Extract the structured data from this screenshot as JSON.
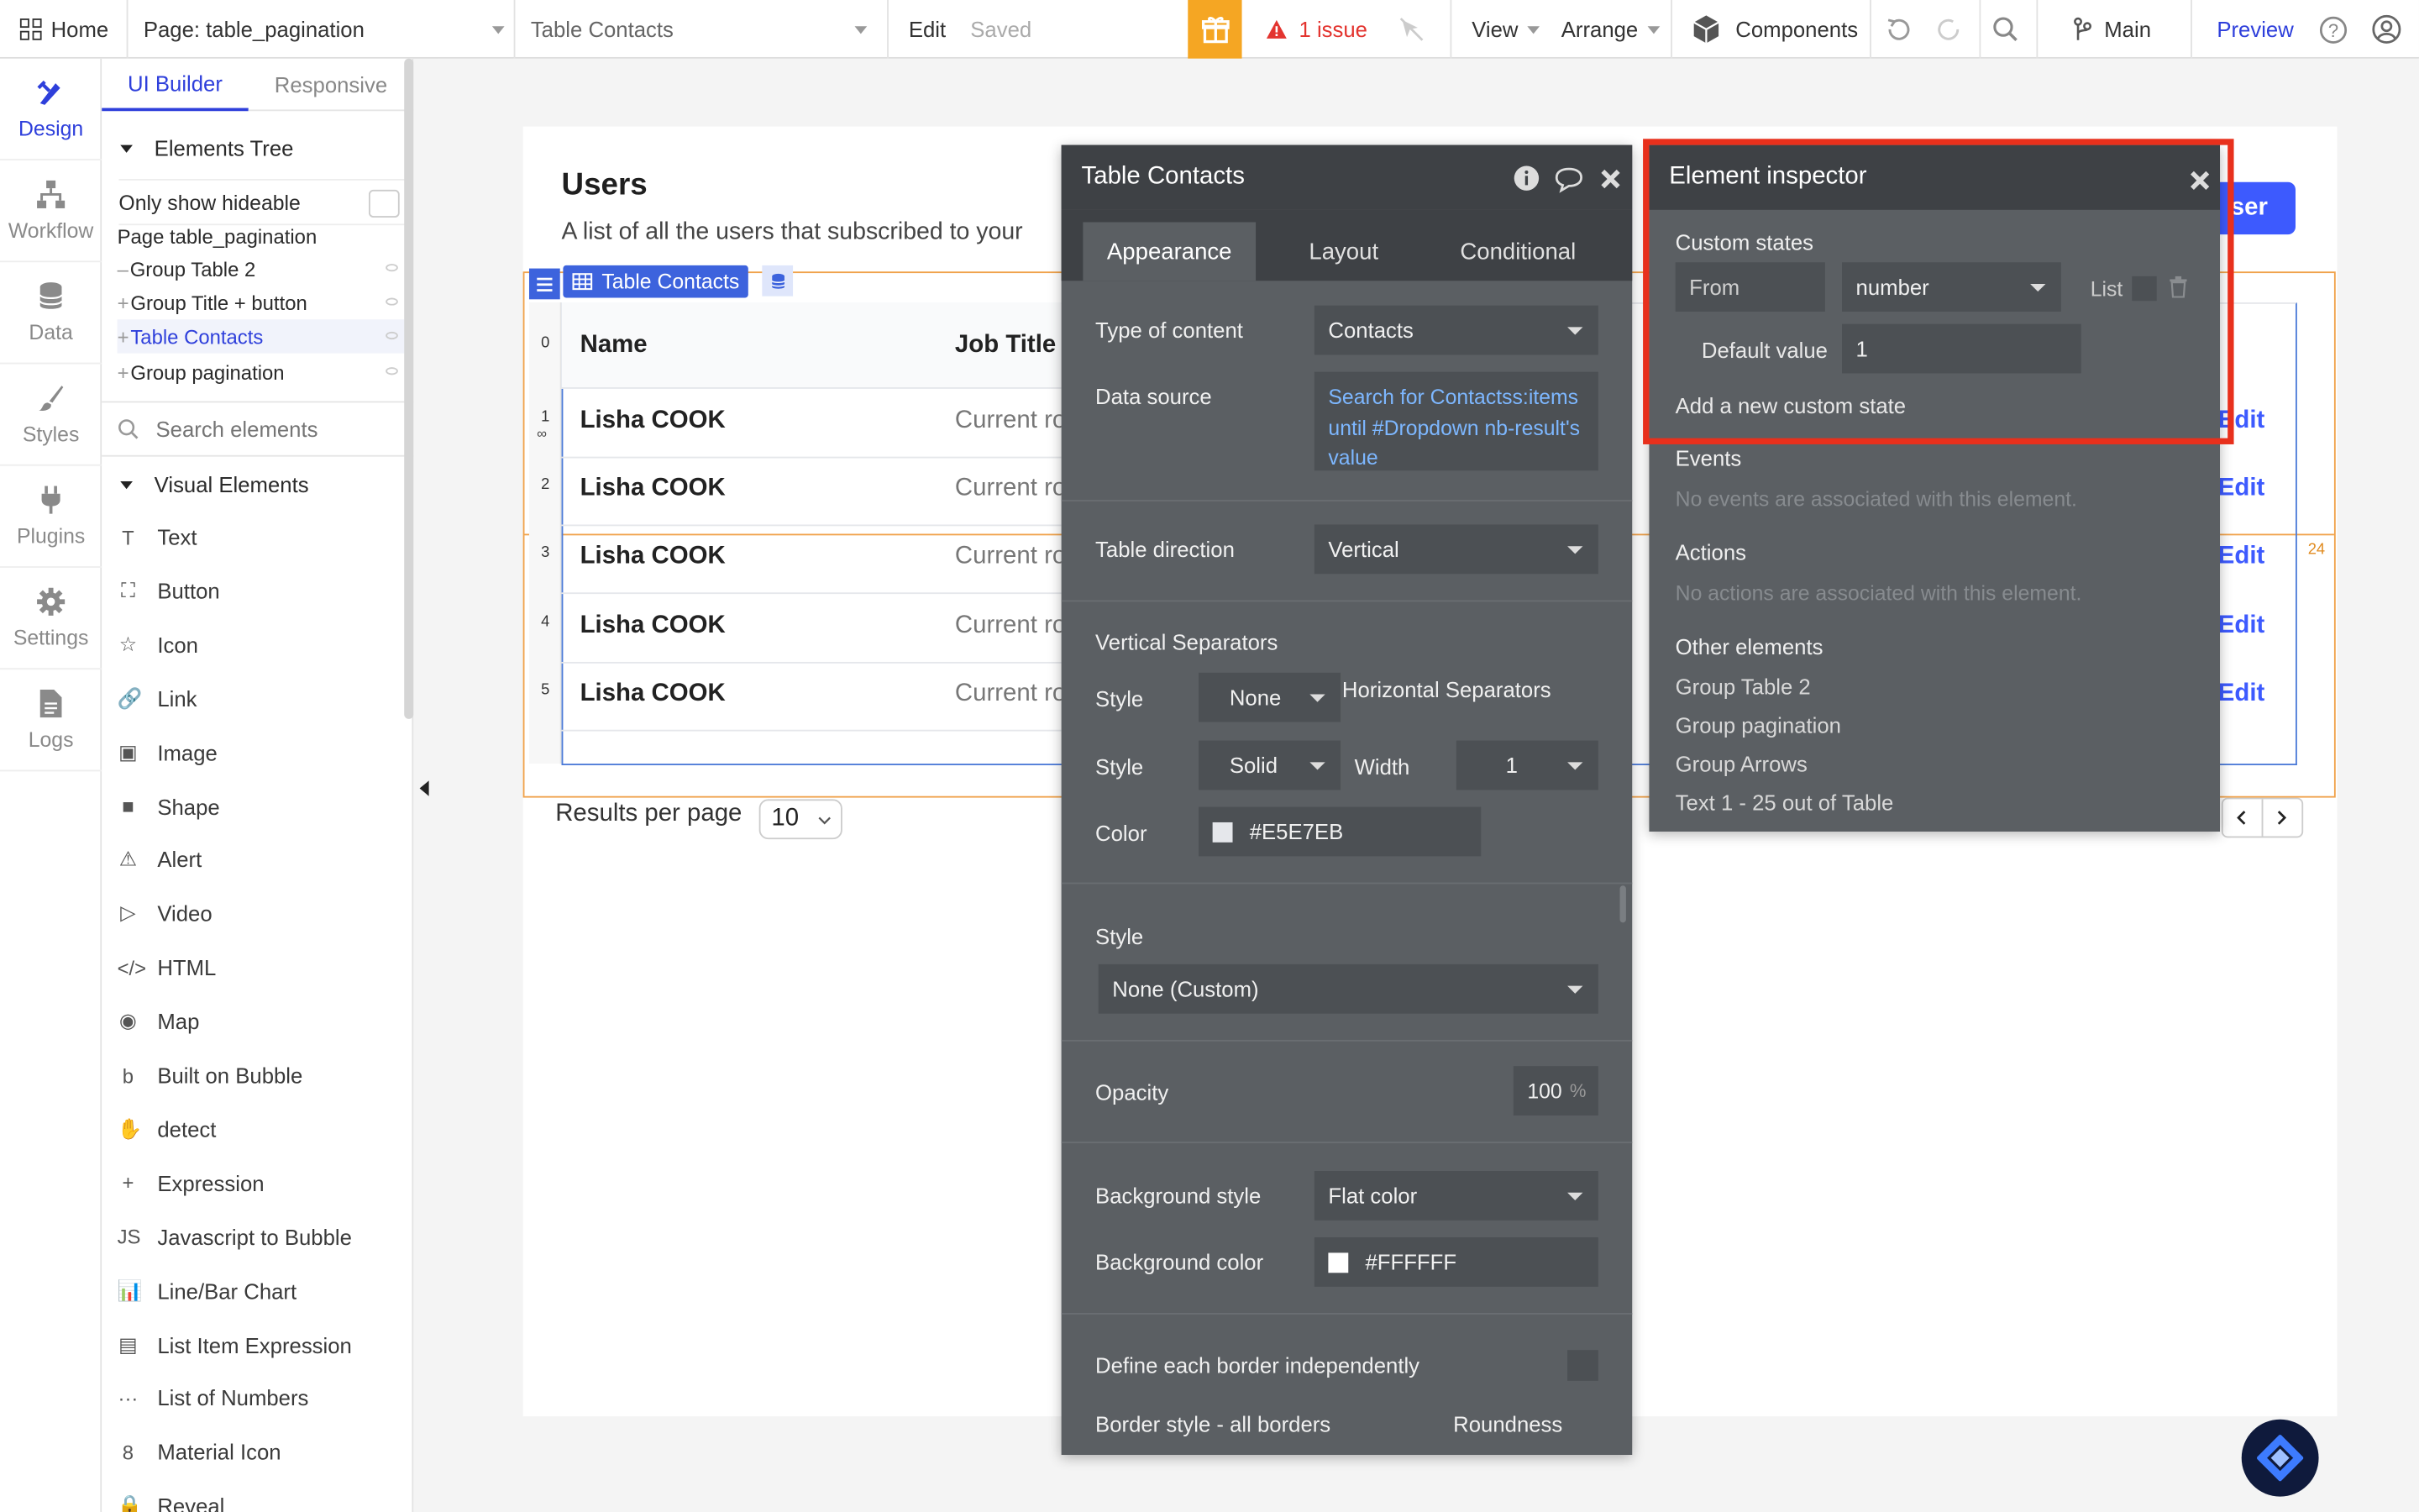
{
  "topbar": {
    "home": "Home",
    "page_selector": "Page: table_pagination",
    "element_selector": "Table Contacts",
    "edit": "Edit",
    "saved": "Saved",
    "issues": "1 issue",
    "view": "View",
    "arrange": "Arrange",
    "components": "Components",
    "branch": "Main",
    "preview": "Preview"
  },
  "rail": [
    {
      "label": "Design",
      "icon": "design-icon"
    },
    {
      "label": "Workflow",
      "icon": "workflow-icon"
    },
    {
      "label": "Data",
      "icon": "database-icon"
    },
    {
      "label": "Styles",
      "icon": "brush-icon"
    },
    {
      "label": "Plugins",
      "icon": "plug-icon"
    },
    {
      "label": "Settings",
      "icon": "gear-icon"
    },
    {
      "label": "Logs",
      "icon": "document-icon"
    }
  ],
  "left_panel": {
    "tab_ui_builder": "UI Builder",
    "tab_responsive": "Responsive",
    "elements_tree": "Elements Tree",
    "only_show_hideable": "Only show hideable",
    "tree": [
      {
        "label": "Page table_pagination",
        "prefix": ""
      },
      {
        "label": "Group Table 2",
        "prefix": "–"
      },
      {
        "label": "Group Title + button",
        "prefix": "+"
      },
      {
        "label": "Table Contacts",
        "prefix": "+"
      },
      {
        "label": "Group pagination",
        "prefix": "+"
      }
    ],
    "search_placeholder": "Search elements",
    "visual_elements": "Visual Elements",
    "elements": [
      {
        "label": "Text",
        "icon": "T"
      },
      {
        "label": "Button",
        "icon": "⛶"
      },
      {
        "label": "Icon",
        "icon": "☆"
      },
      {
        "label": "Link",
        "icon": "🔗"
      },
      {
        "label": "Image",
        "icon": "▣"
      },
      {
        "label": "Shape",
        "icon": "■"
      },
      {
        "label": "Alert",
        "icon": "⚠"
      },
      {
        "label": "Video",
        "icon": "▷"
      },
      {
        "label": "HTML",
        "icon": "</>"
      },
      {
        "label": "Map",
        "icon": "◉"
      },
      {
        "label": "Built on Bubble",
        "icon": "b"
      },
      {
        "label": "detect",
        "icon": "✋"
      },
      {
        "label": "Expression",
        "icon": "+"
      },
      {
        "label": "Javascript to Bubble",
        "icon": "JS"
      },
      {
        "label": "Line/Bar Chart",
        "icon": "📊"
      },
      {
        "label": "List Item Expression",
        "icon": "▤"
      },
      {
        "label": "List of Numbers",
        "icon": "···"
      },
      {
        "label": "Material Icon",
        "icon": "8"
      },
      {
        "label": "Reveal",
        "icon": "🔒"
      }
    ]
  },
  "canvas": {
    "users_title": "Users",
    "users_subtitle": "A list of all the users that subscribed to your",
    "add_user_partial": "ser",
    "table_tag": "Table Contacts",
    "col_name": "Name",
    "col_job": "Job Title",
    "rows": [
      {
        "index": "1",
        "name": "Lisha COOK",
        "job": "Current ro",
        "edit": "Edit"
      },
      {
        "index": "2",
        "name": "Lisha COOK",
        "job": "Current ro",
        "edit": "Edit"
      },
      {
        "index": "3",
        "name": "Lisha COOK",
        "job": "Current ro",
        "edit": "Edit"
      },
      {
        "index": "4",
        "name": "Lisha COOK",
        "job": "Current ro",
        "edit": "Edit"
      },
      {
        "index": "5",
        "name": "Lisha COOK",
        "job": "Current ro",
        "edit": "Edit"
      }
    ],
    "header_index": "0",
    "margin_left": "24",
    "margin_right": "24",
    "results_per_page": "Results per page",
    "results_value": "10"
  },
  "property_panel": {
    "title": "Table Contacts",
    "tabs": [
      "Appearance",
      "Layout",
      "Conditional"
    ],
    "type_of_content_label": "Type of content",
    "type_of_content_value": "Contacts",
    "data_source_label": "Data source",
    "data_source_value": "Search for Contactss:items until #Dropdown nb-result's value",
    "table_direction_label": "Table direction",
    "table_direction_value": "Vertical",
    "vertical_separators": "Vertical Separators",
    "horizontal_separators": "Horizontal Separators",
    "style_label": "Style",
    "vsep_style_value": "None",
    "hsep_style_value": "Solid",
    "width_label": "Width",
    "width_value": "1",
    "color_label": "Color",
    "color_value": "#E5E7EB",
    "style_section_label": "Style",
    "style_value": "None (Custom)",
    "opacity_label": "Opacity",
    "opacity_value": "100",
    "opacity_unit": "%",
    "bg_style_label": "Background style",
    "bg_style_value": "Flat color",
    "bg_color_label": "Background color",
    "bg_color_value": "#FFFFFF",
    "border_independent_label": "Define each border independently",
    "border_style_label": "Border style - all borders",
    "roundness_label": "Roundness"
  },
  "inspector": {
    "title": "Element inspector",
    "custom_states": "Custom states",
    "state_name_placeholder": "From",
    "state_type": "number",
    "list_label": "List",
    "default_value_label": "Default value",
    "default_value": "1",
    "add_custom_state": "Add a new custom state",
    "events_label": "Events",
    "events_empty": "No events are associated with this element.",
    "actions_label": "Actions",
    "actions_empty": "No actions are associated with this element.",
    "other_elements_label": "Other elements",
    "other_elements": [
      "Group Table 2",
      "Group pagination",
      "Group Arrows",
      "Text 1 - 25 out of Table"
    ]
  },
  "colors": {
    "accent_blue": "#2e3fdb",
    "highlight_red": "#e8301c",
    "gift_yellow": "#f5a623",
    "issue_red": "#e3342f",
    "selection_orange": "#f0a24b",
    "panel_gray": "#5b5f63"
  }
}
